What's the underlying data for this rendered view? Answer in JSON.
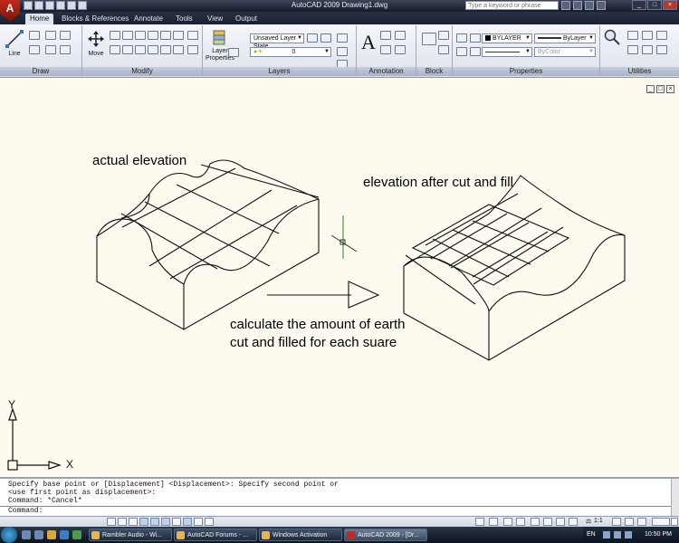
{
  "window": {
    "title": "AutoCAD 2009 Drawing1.dwg",
    "search_placeholder": "Type a keyword or phrase"
  },
  "logo": {
    "letter": "A"
  },
  "tabs": [
    "Home",
    "Blocks & References",
    "Annotate",
    "Tools",
    "View",
    "Output"
  ],
  "ribbon": {
    "draw": {
      "name": "Draw",
      "line_label": "Line"
    },
    "modify": {
      "name": "Modify",
      "move_label": "Move"
    },
    "layers": {
      "name": "Layers",
      "layer_properties_label": "Layer Properties",
      "layer_state": "Unsaved Layer State",
      "current_layer": "0"
    },
    "annotation": {
      "name": "Annotation"
    },
    "block": {
      "name": "Block"
    },
    "properties": {
      "name": "Properties",
      "color": "BYLAYER",
      "lineweight": "ByLayer",
      "plotstyle": "ByColor"
    },
    "utilities": {
      "name": "Utilities"
    }
  },
  "drawing": {
    "text_actual": "actual elevation",
    "text_after": "elevation after cut and fill",
    "text_calc_1": "calculate the amount of earth",
    "text_calc_2": "cut and filled for each suare",
    "ucs_y": "Y",
    "ucs_x": "X"
  },
  "command_line": {
    "lines": [
      "Specify base point or [Displacement] <Displacement>: Specify second point or",
      "<use first point as displacement>:",
      "Command: *Cancel*"
    ],
    "prompt": "Command:"
  },
  "status": {
    "scale": "1:1"
  },
  "taskbar": {
    "tasks": [
      "Rambler Audio - Wi...",
      "AutoCAD Forums - ...",
      "Windows Activation",
      "AutoCAD 2009 - [Dr..."
    ],
    "lang": "EN",
    "clock": "10:50 PM"
  },
  "colors": {
    "canvas": "#fdfbf0",
    "titlebar": "#161b29",
    "ribbon": "#dce2ec",
    "crosshair": "#1e8a1e"
  }
}
